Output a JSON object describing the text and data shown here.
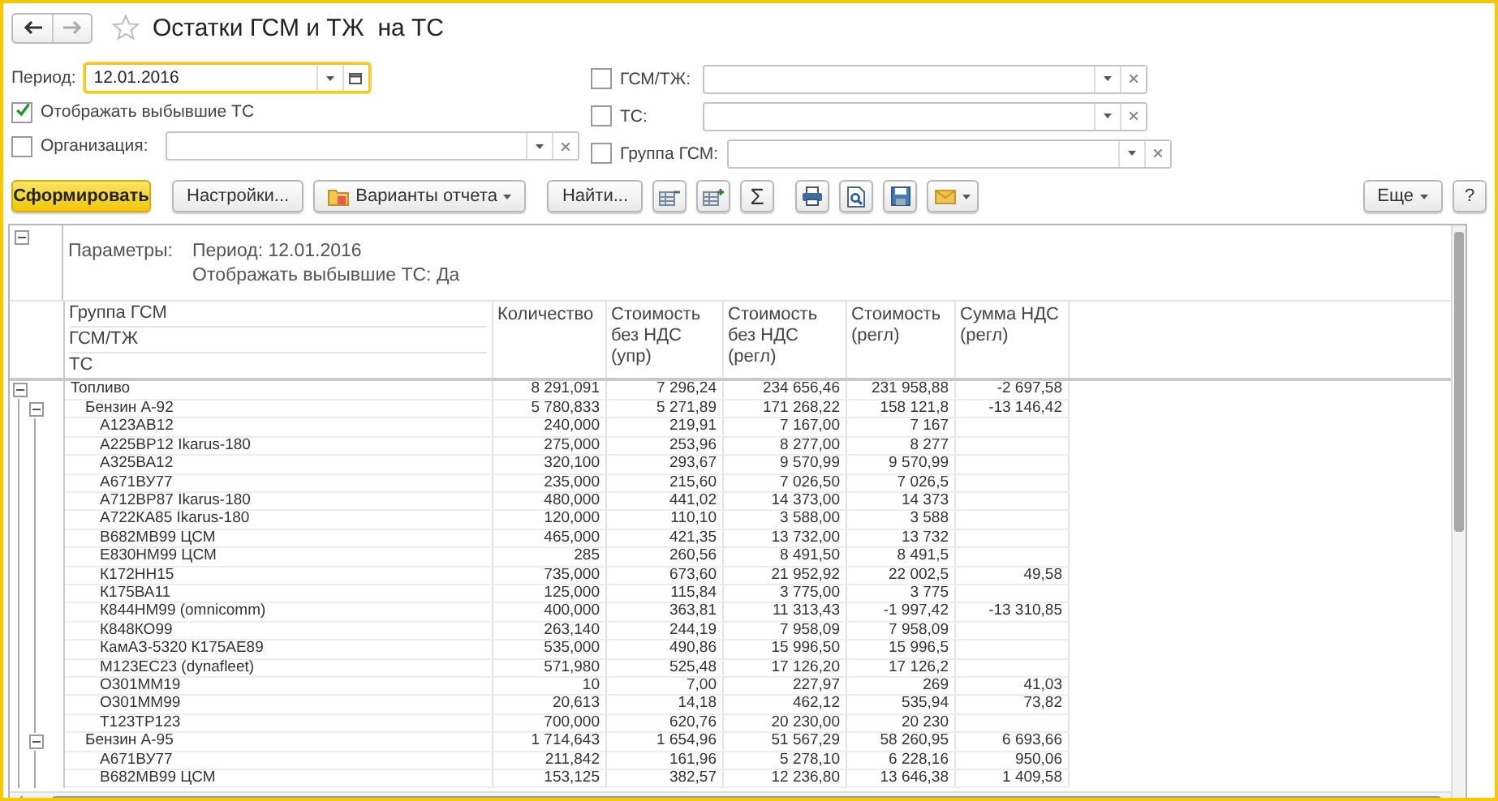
{
  "window": {
    "title": "Остатки ГСМ и ТЖ  на ТС"
  },
  "filters": {
    "period": {
      "label": "Период:",
      "value": "12.01.2016",
      "focused": true
    },
    "show_disposed": {
      "label": "Отображать выбывшие ТС",
      "checked": true
    },
    "organization": {
      "label": "Организация:",
      "checked": false
    },
    "right": [
      {
        "label": "ГСМ/ТЖ:",
        "checked": false
      },
      {
        "label": "ТС:",
        "checked": false
      },
      {
        "label": "Группа ГСМ:",
        "checked": false
      }
    ]
  },
  "toolbar": {
    "generate": "Сформировать",
    "settings": "Настройки...",
    "variants": "Варианты отчета",
    "find": "Найти...",
    "sum": "Σ",
    "more": "Еще",
    "help": "?"
  },
  "report": {
    "params_label": "Параметры:",
    "params": [
      "Период: 12.01.2016",
      "Отображать выбывшие ТС: Да"
    ],
    "group_levels": [
      "Группа ГСМ",
      "ГСМ/ТЖ",
      "ТС"
    ],
    "columns": [
      "Количество",
      "Стоимость без НДС (упр)",
      "Стоимость без НДС (регл)",
      "Стоимость (регл)",
      "Сумма НДС (регл)"
    ],
    "rows": [
      {
        "name": "Топливо",
        "expanded": true,
        "values": [
          "8 291,091",
          "7 296,24",
          "234 656,46",
          "231 958,88",
          "-2 697,58"
        ],
        "children": [
          {
            "name": "Бензин А-92",
            "expanded": true,
            "values": [
              "5 780,833",
              "5 271,89",
              "171 268,22",
              "158 121,8",
              "-13 146,42"
            ],
            "children": [
              {
                "name": "А123АВ12",
                "values": [
                  "240,000",
                  "219,91",
                  "7 167,00",
                  "7 167"
                ]
              },
              {
                "name": "А225ВР12 Ikarus-180",
                "values": [
                  "275,000",
                  "253,96",
                  "8 277,00",
                  "8 277"
                ]
              },
              {
                "name": "А325ВА12",
                "values": [
                  "320,100",
                  "293,67",
                  "9 570,99",
                  "9 570,99"
                ]
              },
              {
                "name": "А671ВУ77",
                "values": [
                  "235,000",
                  "215,60",
                  "7 026,50",
                  "7 026,5"
                ]
              },
              {
                "name": "А712ВР87 Ikarus-180",
                "values": [
                  "480,000",
                  "441,02",
                  "14 373,00",
                  "14 373"
                ]
              },
              {
                "name": "А722КА85 Ikarus-180",
                "values": [
                  "120,000",
                  "110,10",
                  "3 588,00",
                  "3 588"
                ]
              },
              {
                "name": "В682МВ99 ЦСМ",
                "values": [
                  "465,000",
                  "421,35",
                  "13 732,00",
                  "13 732"
                ]
              },
              {
                "name": "Е830НМ99 ЦСМ",
                "values": [
                  "285",
                  "260,56",
                  "8 491,50",
                  "8 491,5"
                ]
              },
              {
                "name": "К172НН15",
                "values": [
                  "735,000",
                  "673,60",
                  "21 952,92",
                  "22 002,5",
                  "49,58"
                ]
              },
              {
                "name": "К175ВА11",
                "values": [
                  "125,000",
                  "115,84",
                  "3 775,00",
                  "3 775"
                ]
              },
              {
                "name": "К844НМ99 (omnicomm)",
                "values": [
                  "400,000",
                  "363,81",
                  "11 313,43",
                  "-1 997,42",
                  "-13 310,85"
                ]
              },
              {
                "name": "К848КО99",
                "values": [
                  "263,140",
                  "244,19",
                  "7 958,09",
                  "7 958,09"
                ]
              },
              {
                "name": "КамАЗ-5320 К175АЕ89",
                "values": [
                  "535,000",
                  "490,86",
                  "15 996,50",
                  "15 996,5"
                ]
              },
              {
                "name": "М123ЕС23 (dynafleet)",
                "values": [
                  "571,980",
                  "525,48",
                  "17 126,20",
                  "17 126,2"
                ]
              },
              {
                "name": "О301ММ19",
                "values": [
                  "10",
                  "7,00",
                  "227,97",
                  "269",
                  "41,03"
                ]
              },
              {
                "name": "О301ММ99",
                "values": [
                  "20,613",
                  "14,18",
                  "462,12",
                  "535,94",
                  "73,82"
                ]
              },
              {
                "name": "Т123ТР123",
                "values": [
                  "700,000",
                  "620,76",
                  "20 230,00",
                  "20 230"
                ]
              }
            ]
          },
          {
            "name": "Бензин А-95",
            "expanded": true,
            "values": [
              "1 714,643",
              "1 654,96",
              "51 567,29",
              "58 260,95",
              "6 693,66"
            ],
            "children": [
              {
                "name": "А671ВУ77",
                "values": [
                  "211,842",
                  "161,96",
                  "5 278,10",
                  "6 228,16",
                  "950,06"
                ]
              },
              {
                "name": "В682МВ99 ЦСМ",
                "values": [
                  "153,125",
                  "382,57",
                  "12 236,80",
                  "13 646,38",
                  "1 409,58"
                ]
              }
            ]
          }
        ]
      }
    ]
  }
}
